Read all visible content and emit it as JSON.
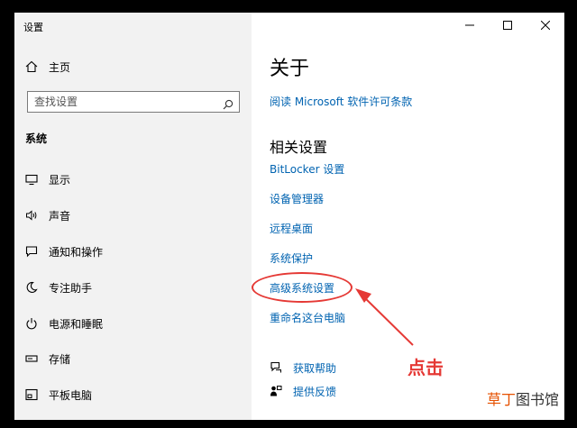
{
  "window": {
    "title": "设置"
  },
  "sidebar": {
    "home_label": "主页",
    "search_placeholder": "查找设置",
    "section_title": "系统",
    "items": [
      {
        "label": "显示",
        "icon": "display-icon"
      },
      {
        "label": "声音",
        "icon": "speaker-icon"
      },
      {
        "label": "通知和操作",
        "icon": "notification-icon"
      },
      {
        "label": "专注助手",
        "icon": "moon-icon"
      },
      {
        "label": "电源和睡眠",
        "icon": "power-icon"
      },
      {
        "label": "存储",
        "icon": "storage-icon"
      },
      {
        "label": "平板电脑",
        "icon": "tablet-icon"
      }
    ]
  },
  "main": {
    "title": "关于",
    "license_link": "阅读 Microsoft 软件许可条款",
    "related_title": "相关设置",
    "related_links": [
      "BitLocker 设置",
      "设备管理器",
      "远程桌面",
      "系统保护",
      "高级系统设置",
      "重命名这台电脑"
    ],
    "help_links": [
      {
        "label": "获取帮助",
        "icon": "help-chat-icon"
      },
      {
        "label": "提供反馈",
        "icon": "feedback-icon"
      }
    ]
  },
  "annotation": {
    "text": "点击",
    "color": "#e53935"
  },
  "watermark": {
    "accent": "草丁",
    "rest": "图书馆"
  },
  "colors": {
    "link": "#0063b1",
    "sidebar_bg": "#f2f2f2",
    "annotation": "#e53935"
  }
}
